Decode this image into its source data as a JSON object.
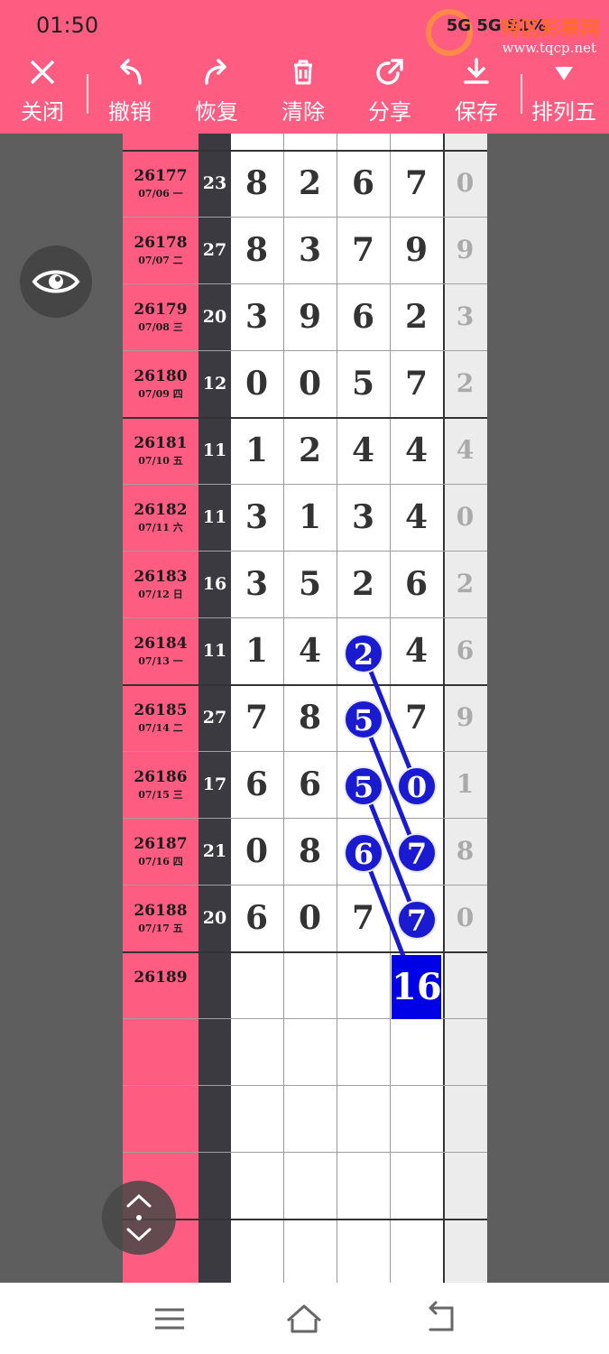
{
  "status": {
    "time": "01:50",
    "right": "5G 5G 81%"
  },
  "watermark": {
    "text": "特区彩票网",
    "url": "www.tqcp.net"
  },
  "toolbar": {
    "close": "关闭",
    "undo": "撤销",
    "redo": "恢复",
    "clear": "清除",
    "share": "分享",
    "save": "保存",
    "mode": "排列五"
  },
  "rows": [
    {
      "issue": "26177",
      "date": "07/06 一",
      "sum": "23",
      "d": [
        "8",
        "2",
        "6",
        "7"
      ],
      "ext": "0"
    },
    {
      "issue": "26178",
      "date": "07/07 二",
      "sum": "27",
      "d": [
        "8",
        "3",
        "7",
        "9"
      ],
      "ext": "9"
    },
    {
      "issue": "26179",
      "date": "07/08 三",
      "sum": "20",
      "d": [
        "3",
        "9",
        "6",
        "2"
      ],
      "ext": "3"
    },
    {
      "issue": "26180",
      "date": "07/09 四",
      "sum": "12",
      "d": [
        "0",
        "0",
        "5",
        "7"
      ],
      "ext": "2"
    },
    {
      "issue": "26181",
      "date": "07/10 五",
      "sum": "11",
      "d": [
        "1",
        "2",
        "4",
        "4"
      ],
      "ext": "4"
    },
    {
      "issue": "26182",
      "date": "07/11 六",
      "sum": "11",
      "d": [
        "3",
        "1",
        "3",
        "4"
      ],
      "ext": "0"
    },
    {
      "issue": "26183",
      "date": "07/12 日",
      "sum": "16",
      "d": [
        "3",
        "5",
        "2",
        "6"
      ],
      "ext": "2"
    },
    {
      "issue": "26184",
      "date": "07/13 一",
      "sum": "11",
      "d": [
        "1",
        "4",
        "2",
        "4"
      ],
      "ext": "6"
    },
    {
      "issue": "26185",
      "date": "07/14 二",
      "sum": "27",
      "d": [
        "7",
        "8",
        "5",
        "7"
      ],
      "ext": "9"
    },
    {
      "issue": "26186",
      "date": "07/15 三",
      "sum": "17",
      "d": [
        "6",
        "6",
        "5",
        "0"
      ],
      "ext": "1"
    },
    {
      "issue": "26187",
      "date": "07/16 四",
      "sum": "21",
      "d": [
        "0",
        "8",
        "6",
        "7"
      ],
      "ext": "8"
    },
    {
      "issue": "26188",
      "date": "07/17 五",
      "sum": "20",
      "d": [
        "6",
        "0",
        "7",
        "7"
      ],
      "ext": "0"
    }
  ],
  "next_issue": "26189",
  "prediction": "16",
  "colors": {
    "header": "#ff5c82",
    "marker": "#1a1ad0",
    "prediction": "#0000e6"
  }
}
